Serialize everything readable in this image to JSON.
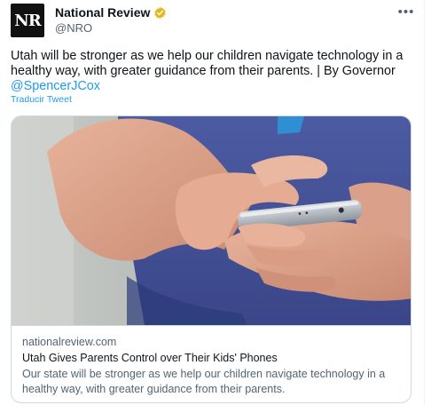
{
  "author": {
    "avatar_text": "NR",
    "display_name": "National Review",
    "handle": "@NRO",
    "verified_color": "#e2b719"
  },
  "more_icon": "more-horizontal-icon",
  "tweet": {
    "text_before": "Utah will be stronger as we help our children navigate technology in a healthy way, with greater guidance from their parents. | By Governor ",
    "mention": "@SpencerJCox",
    "translate_label": "Traducir Tweet"
  },
  "card": {
    "image_icon": "phone-photo",
    "domain": "nationalreview.com",
    "title": "Utah Gives Parents Control over Their Kids' Phones",
    "description": "Our state will be stronger as we help our children navigate technology in a healthy way, with greater guidance from their parents."
  },
  "colors": {
    "link": "#1d9bf0",
    "secondary_text": "#536471",
    "border": "#cfd9de"
  }
}
